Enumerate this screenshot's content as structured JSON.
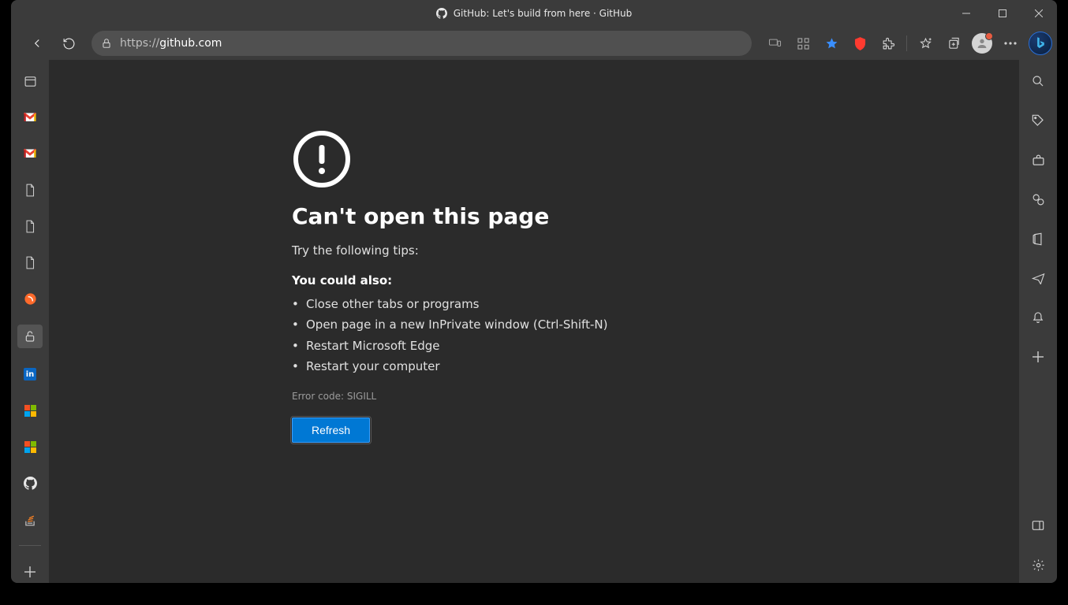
{
  "window": {
    "title": "GitHub: Let's build from here · GitHub"
  },
  "toolbar": {
    "url_scheme": "https://",
    "url_host": "github.com"
  },
  "error": {
    "title": "Can't open this page",
    "tip": "Try the following tips:",
    "subtitle": "You could also:",
    "suggestions": [
      "Close other tabs or programs",
      "Open page in a new InPrivate window (Ctrl-Shift-N)",
      "Restart Microsoft Edge",
      "Restart your computer"
    ],
    "code": "Error code: SIGILL",
    "refresh_label": "Refresh"
  },
  "left_rail": {
    "items": [
      "tab-actions",
      "gmail-1",
      "gmail-2",
      "doc-1",
      "doc-2",
      "doc-3",
      "fanyi",
      "lock",
      "linkedin",
      "microsoft-1",
      "microsoft-2",
      "github",
      "stackoverflow"
    ]
  },
  "right_rail": {
    "items": [
      "search",
      "tag",
      "briefcase",
      "performance",
      "office",
      "send",
      "notifications",
      "add"
    ],
    "bottom": [
      "sidebar-toggle",
      "settings"
    ]
  }
}
